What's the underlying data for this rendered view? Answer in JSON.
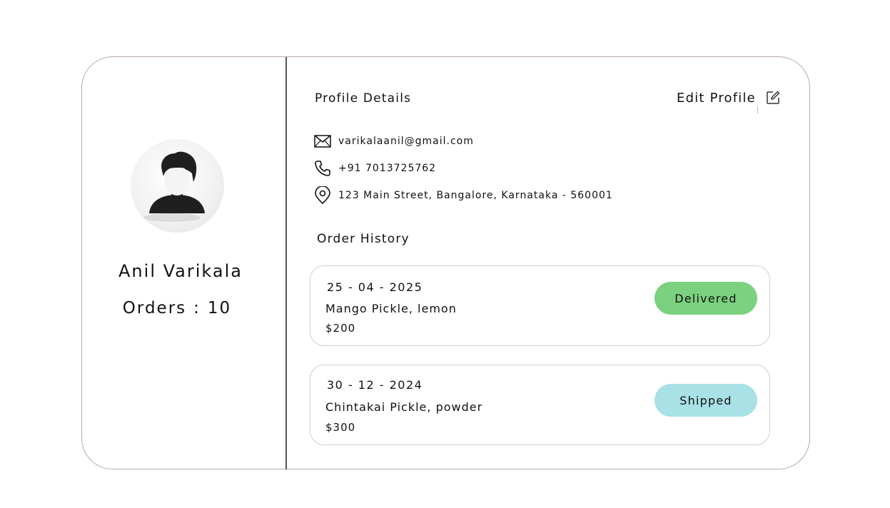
{
  "profile": {
    "name": "Anil Varikala",
    "orders_label": "Orders",
    "orders_separator": ":",
    "orders_count": "10"
  },
  "details": {
    "title": "Profile Details",
    "edit_label": "Edit Profile",
    "email": "varikalaanil@gmail.com",
    "phone": "+91 7013725762",
    "address": "123 Main Street, Bangalore, Karnataka - 560001"
  },
  "order_history": {
    "title": "Order History",
    "orders": [
      {
        "date": "25 - 04 - 2025",
        "items": "Mango Pickle, lemon",
        "price": "$200",
        "status": "Delivered",
        "status_color": "#7bd17f"
      },
      {
        "date": "30 - 12 - 2024",
        "items": "Chintakai Pickle, powder",
        "price": "$300",
        "status": "Shipped",
        "status_color": "#a8e1e6"
      }
    ]
  },
  "icons": {
    "email": "mail-icon",
    "phone": "phone-icon",
    "address": "location-pin-icon",
    "edit": "edit-icon",
    "avatar": "user-avatar"
  }
}
